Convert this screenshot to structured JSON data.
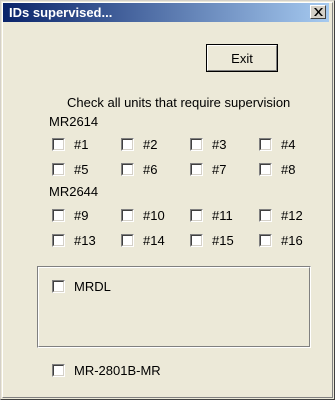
{
  "window": {
    "title": "IDs supervised..."
  },
  "buttons": {
    "exit_label": "Exit"
  },
  "instructions": "Check all units that require supervision",
  "groups": {
    "mr2614": {
      "label": "MR2614",
      "units": [
        "#1",
        "#2",
        "#3",
        "#4",
        "#5",
        "#6",
        "#7",
        "#8"
      ]
    },
    "mr2644": {
      "label": "MR2644",
      "units": [
        "#9",
        "#10",
        "#11",
        "#12",
        "#13",
        "#14",
        "#15",
        "#16"
      ]
    }
  },
  "mrdl_label": "MRDL",
  "mr2801b_label": "MR-2801B-MR",
  "checked": {
    "units": [
      false,
      false,
      false,
      false,
      false,
      false,
      false,
      false,
      false,
      false,
      false,
      false,
      false,
      false,
      false,
      false
    ],
    "mrdl": false,
    "mr2801b": false
  }
}
